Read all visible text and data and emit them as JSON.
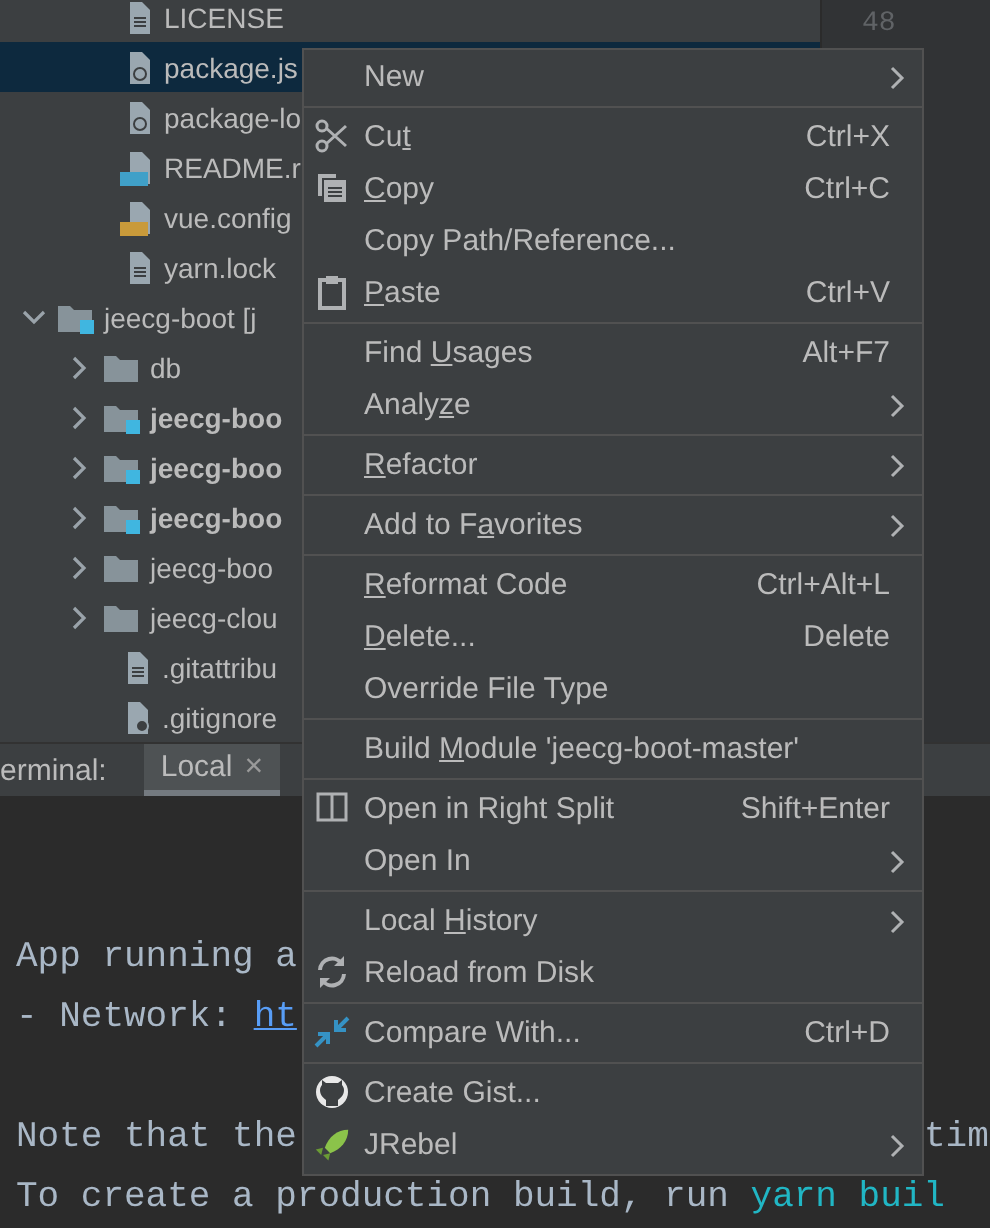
{
  "project_tree": [
    {
      "label": "LICENSE",
      "kind": "text",
      "selected": false
    },
    {
      "label": "package.js",
      "kind": "json",
      "selected": true
    },
    {
      "label": "package-lo",
      "kind": "json",
      "selected": false
    },
    {
      "label": "README.r",
      "kind": "markdown",
      "selected": false
    },
    {
      "label": "vue.config",
      "kind": "javascript",
      "selected": false
    },
    {
      "label": "yarn.lock",
      "kind": "text",
      "selected": false
    },
    {
      "label": "jeecg-boot [j",
      "kind": "module",
      "selected": false,
      "expanded": true,
      "children": [
        {
          "label": "db",
          "kind": "folder",
          "selected": false,
          "expanded": false
        },
        {
          "label": "jeecg-boo",
          "kind": "module",
          "selected": false,
          "expanded": false,
          "bold": true
        },
        {
          "label": "jeecg-boo",
          "kind": "module",
          "selected": false,
          "expanded": false,
          "bold": true
        },
        {
          "label": "jeecg-boo",
          "kind": "module",
          "selected": false,
          "expanded": false,
          "bold": true
        },
        {
          "label": "jeecg-boo",
          "kind": "folder",
          "selected": false,
          "expanded": false,
          "bold": false
        },
        {
          "label": "jeecg-clou",
          "kind": "folder",
          "selected": false,
          "expanded": false,
          "bold": false
        },
        {
          "label": ".gitattribu",
          "kind": "text",
          "selected": false
        },
        {
          "label": ".gitignore",
          "kind": "ignore",
          "selected": false
        }
      ]
    }
  ],
  "gutter": {
    "line_number": "48"
  },
  "terminal": {
    "title": "erminal:",
    "tabs": [
      {
        "label": "Local",
        "close": "×",
        "selected": true
      }
    ],
    "lines": [
      {
        "kind": "text",
        "text": "App running a"
      },
      {
        "kind": "link",
        "text": "- Network: ",
        "link": "ht"
      },
      {
        "kind": "blank"
      },
      {
        "kind": "split",
        "text": "Note that the",
        "tail": "tim"
      },
      {
        "kind": "command",
        "text": "To create a production build, run ",
        "command": "yarn buil"
      }
    ]
  },
  "context_menu": {
    "groups": [
      [
        {
          "label": "New",
          "submenu": true
        }
      ],
      [
        {
          "label": "Cu",
          "mnemonic": "t",
          "shortcut": "Ctrl+X",
          "kind": "cut"
        },
        {
          "mnemonic": "C",
          "label_rest": "opy",
          "shortcut": "Ctrl+C",
          "kind": "copy"
        },
        {
          "label": "Copy Path/Reference..."
        },
        {
          "mnemonic": "P",
          "label_rest": "aste",
          "shortcut": "Ctrl+V",
          "kind": "paste"
        }
      ],
      [
        {
          "label": "Find ",
          "mnemonic": "U",
          "label_rest": "sages",
          "shortcut": "Alt+F7"
        },
        {
          "label": "Analy",
          "mnemonic": "z",
          "label_rest": "e",
          "submenu": true
        }
      ],
      [
        {
          "mnemonic": "R",
          "label_rest": "efactor",
          "submenu": true
        }
      ],
      [
        {
          "label": "Add to F",
          "mnemonic": "a",
          "label_rest": "vorites",
          "submenu": true
        }
      ],
      [
        {
          "mnemonic": "R",
          "label_rest": "eformat Code",
          "shortcut": "Ctrl+Alt+L"
        },
        {
          "mnemonic": "D",
          "label_rest": "elete...",
          "shortcut": "Delete"
        },
        {
          "label": "Override File Type"
        }
      ],
      [
        {
          "label": "Build ",
          "mnemonic": "M",
          "label_rest": "odule 'jeecg-boot-master'"
        }
      ],
      [
        {
          "label": "Open in Right Split",
          "shortcut": "Shift+Enter",
          "kind": "split"
        },
        {
          "label": "Open In",
          "submenu": true
        }
      ],
      [
        {
          "label": "Local ",
          "mnemonic": "H",
          "label_rest": "istory",
          "submenu": true
        },
        {
          "label": "Reload from Disk",
          "kind": "reload"
        }
      ],
      [
        {
          "label": "Compare With...",
          "shortcut": "Ctrl+D",
          "kind": "compare"
        }
      ],
      [
        {
          "label": "Create Gist...",
          "kind": "github"
        },
        {
          "label": "JRebel",
          "submenu": true,
          "kind": "rocket"
        }
      ]
    ]
  }
}
